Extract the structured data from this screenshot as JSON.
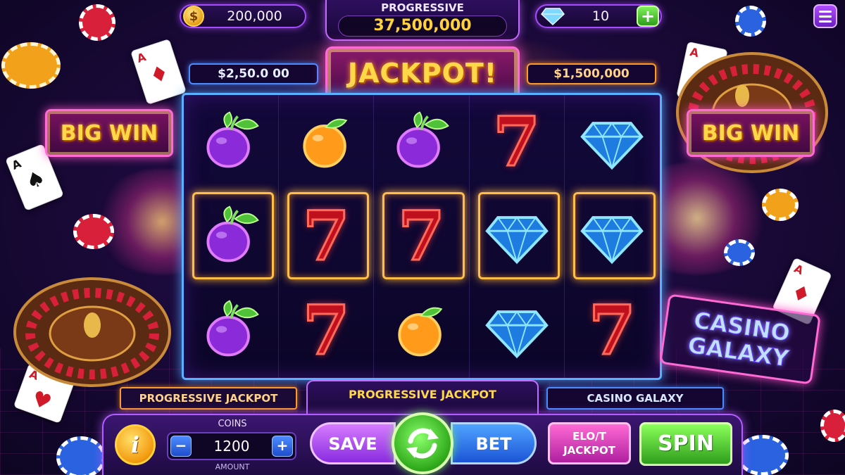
{
  "top_bar": {
    "coins": "200,000",
    "coin_symbol": "$",
    "progressive_label": "PROGRESSIVE",
    "progressive_value": "37,500,000",
    "gems": "10",
    "plus_label": "+"
  },
  "jackpot": {
    "title": "JACKPOT!",
    "left_value": "$2,50.0 00",
    "right_value": "$1,500,000"
  },
  "big_win_left": "BIG WIN",
  "big_win_right": "BIG WIN",
  "casino_galaxy_sign": {
    "line1": "CASINO",
    "line2": "GALAXY"
  },
  "reels": {
    "rows": [
      [
        "plum",
        "orange",
        "plum",
        "seven",
        "diamond"
      ],
      [
        "plum",
        "seven",
        "seven",
        "diamond",
        "diamond"
      ],
      [
        "plum",
        "seven",
        "orange",
        "diamond",
        "seven"
      ]
    ],
    "winning_row": 1,
    "seven_glyph": "7"
  },
  "labels": {
    "left": "PROGRESSIVE JACKPOT",
    "center": "PROGRESSIVE JACKPOT",
    "right": "CASINO GALAXY"
  },
  "controls": {
    "info_label": "i",
    "coins_label": "COINS",
    "amount_label": "AMOUNT",
    "bet_amount": "1200",
    "minus_label": "−",
    "plus_label": "+",
    "save_label": "SAVE",
    "bet_label": "BET",
    "elot_line1": "ELO/T",
    "elot_line2": "JACKPOT",
    "spin_label": "SPIN"
  },
  "cards": {
    "ace_rank": "A",
    "spade": "♠",
    "heart": "♥",
    "diamond": "♦"
  },
  "colors": {
    "accent_purple": "#b45cff",
    "gold": "#ffd84a",
    "neon_pink": "#ff6ad5",
    "neon_blue": "#5ab0ff",
    "spin_green": "#2e9e1c"
  }
}
